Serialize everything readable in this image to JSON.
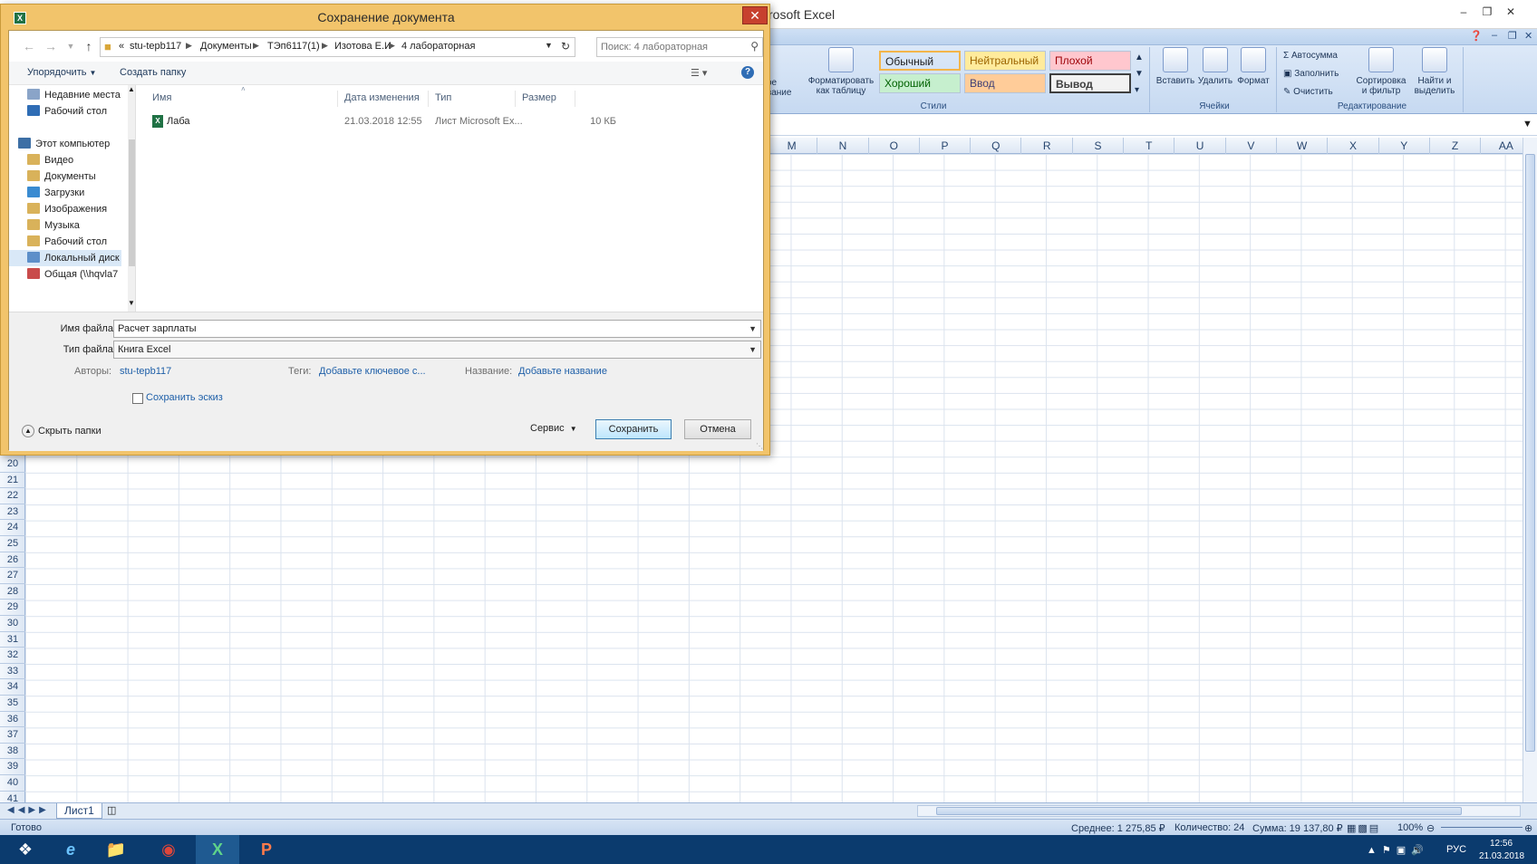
{
  "excel": {
    "title": "rosoft Excel",
    "styles": {
      "group_label": "Стили",
      "cells": [
        {
          "label": "Обычный",
          "bg": "#ffffff",
          "color": "#000000"
        },
        {
          "label": "Нейтральный",
          "bg": "#ffeb9c",
          "color": "#9c6500"
        },
        {
          "label": "Плохой",
          "bg": "#ffc7ce",
          "color": "#9c0006"
        },
        {
          "label": "Хороший",
          "bg": "#c6efce",
          "color": "#006100"
        },
        {
          "label": "Ввод",
          "bg": "#ffcc99",
          "color": "#3f3f76"
        },
        {
          "label": "Вывод",
          "bg": "#f2f2f2",
          "color": "#3f3f3f"
        }
      ]
    },
    "ribbon": {
      "cond_format": "ое\nвание",
      "format_table": "Форматировать\nкак таблицу",
      "cells_group_label": "Ячейки",
      "insert": "Вставить",
      "delete": "Удалить",
      "format": "Формат",
      "edit_group_label": "Редактирование",
      "autosum": "Автосумма",
      "fill": "Заполнить",
      "clear": "Очистить",
      "sort_filter": "Сортировка\nи фильтр",
      "find_select": "Найти и\nвыделить"
    },
    "columns": [
      "M",
      "N",
      "O",
      "P",
      "Q",
      "R",
      "S",
      "T",
      "U",
      "V",
      "W",
      "X",
      "Y",
      "Z",
      "AA"
    ],
    "rows": [
      "20",
      "21",
      "22",
      "23",
      "24",
      "25",
      "26",
      "27",
      "28",
      "29",
      "30",
      "31",
      "32",
      "33",
      "34",
      "35",
      "36",
      "37",
      "38",
      "39",
      "40",
      "41"
    ],
    "sheet_tab": "Лист1",
    "status": {
      "ready": "Готово",
      "average": "Среднее:  1 275,85 ₽",
      "count": "Количество: 24",
      "sum": "Сумма:  19 137,80 ₽",
      "zoom": "100%"
    }
  },
  "taskbar": {
    "lang": "РУС",
    "time": "12:56",
    "date": "21.03.2018"
  },
  "dialog": {
    "title": "Сохранение документа",
    "close": "✕",
    "breadcrumbs": [
      "«",
      "stu-tepb117",
      "Документы",
      "ТЭп6117(1)",
      "Изотова Е.И",
      "4 лабораторная"
    ],
    "search_placeholder": "Поиск: 4 лабораторная",
    "toolbar": {
      "organize": "Упорядочить",
      "new_folder": "Создать папку"
    },
    "nav_items": [
      {
        "label": "Недавние места",
        "color": "#8aa4c8"
      },
      {
        "label": "Рабочий стол",
        "color": "#2f6db5"
      },
      {
        "label": "Этот компьютер",
        "color": "#3d6fa5"
      },
      {
        "label": "Видео",
        "color": "#d9b25a"
      },
      {
        "label": "Документы",
        "color": "#d9b25a"
      },
      {
        "label": "Загрузки",
        "color": "#3a8bd1"
      },
      {
        "label": "Изображения",
        "color": "#d9b25a"
      },
      {
        "label": "Музыка",
        "color": "#d9b25a"
      },
      {
        "label": "Рабочий стол",
        "color": "#d9b25a"
      },
      {
        "label": "Локальный диск",
        "color": "#5d8fc9"
      },
      {
        "label": "Общая (\\\\hqvla7",
        "color": "#c94b4b"
      }
    ],
    "columns": {
      "name": "Имя",
      "date": "Дата изменения",
      "type": "Тип",
      "size": "Размер"
    },
    "files": [
      {
        "name": "Лаба",
        "date": "21.03.2018 12:55",
        "type": "Лист Microsoft Ex...",
        "size": "10 КБ"
      }
    ],
    "form": {
      "filename_label": "Имя файла:",
      "filename_value": "Расчет зарплаты",
      "filetype_label": "Тип файла:",
      "filetype_value": "Книга Excel",
      "authors_label": "Авторы:",
      "authors_value": "stu-tepb117",
      "tags_label": "Теги:",
      "tags_value": "Добавьте ключевое с...",
      "title_label": "Название:",
      "title_value": "Добавьте название",
      "thumbnail_label": "Сохранить эскиз",
      "hide_folders": "Скрыть папки",
      "service": "Сервис",
      "save": "Сохранить",
      "cancel": "Отмена"
    }
  }
}
